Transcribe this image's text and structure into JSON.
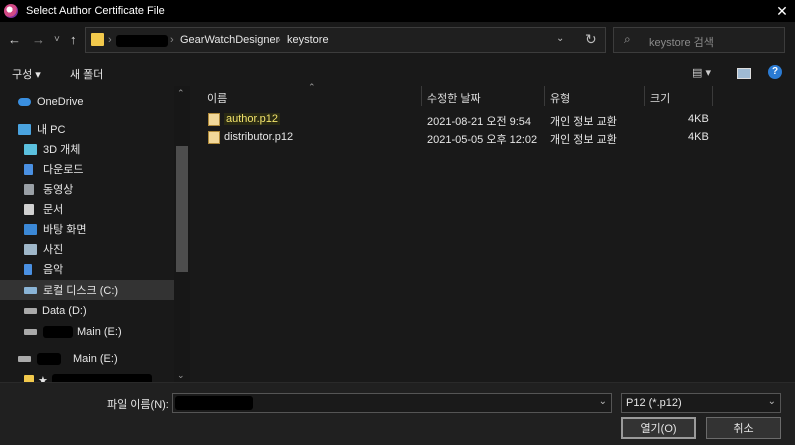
{
  "window": {
    "title": "Select Author Certificate File",
    "close_glyph": "✕"
  },
  "nav": {
    "back": "←",
    "forward": "→",
    "recent": "˅",
    "up": "↑",
    "breadcrumb": [
      "GearWatchDesigner",
      "keystore"
    ],
    "breadcrumb_sep": "›",
    "search_placeholder": "keystore 검색"
  },
  "toolbar": {
    "organize": "구성 ▾",
    "new_folder": "새 폴더",
    "view_icon": "▤ ▾",
    "help": "?"
  },
  "sidebar": {
    "items": [
      {
        "label": "OneDrive",
        "icon": "cloud-icon",
        "color": "#3a8fe0"
      },
      {
        "label": "내 PC",
        "icon": "computer-icon",
        "color": "#4aa3df"
      },
      {
        "label": "3D 개체",
        "icon": "cube-icon",
        "color": "#5bc0de"
      },
      {
        "label": "다운로드",
        "icon": "download-icon",
        "color": "#4a90e2"
      },
      {
        "label": "동영상",
        "icon": "video-icon",
        "color": "#9aa0a6"
      },
      {
        "label": "문서",
        "icon": "document-icon",
        "color": "#d0d0d0"
      },
      {
        "label": "바탕 화면",
        "icon": "desktop-icon",
        "color": "#3b88d6"
      },
      {
        "label": "사진",
        "icon": "picture-icon",
        "color": "#9fb7c9"
      },
      {
        "label": "음악",
        "icon": "music-icon",
        "color": "#4a90e2"
      },
      {
        "label": "로컬 디스크 (C:)",
        "icon": "drive-icon",
        "color": "#8ab4d6"
      },
      {
        "label": "Data (D:)",
        "icon": "drive-icon",
        "color": "#aaaaaa"
      },
      {
        "label": "Main (E:)",
        "icon": "drive-icon",
        "color": "#aaaaaa"
      },
      {
        "label": "Main (E:)",
        "icon": "drive-icon",
        "color": "#aaaaaa"
      },
      {
        "label": "★",
        "icon": "folder-icon",
        "color": "#f2c94c"
      }
    ]
  },
  "filelist": {
    "columns": [
      "이름",
      "수정한 날짜",
      "유형",
      "크기"
    ],
    "rows": [
      {
        "name": "author.p12",
        "modified": "2021-08-21 오전 9:54",
        "type": "개인 정보 교환",
        "size": "4KB"
      },
      {
        "name": "distributor.p12",
        "modified": "2021-05-05 오후 12:02",
        "type": "개인 정보 교환",
        "size": "4KB"
      }
    ]
  },
  "bottom": {
    "filename_label": "파일 이름(N):",
    "filetype": "P12 (*.p12)",
    "open_label": "열기(O)",
    "cancel_label": "취소"
  },
  "colors": {
    "accent_file": "#f2e36b",
    "selection": "#333333"
  }
}
